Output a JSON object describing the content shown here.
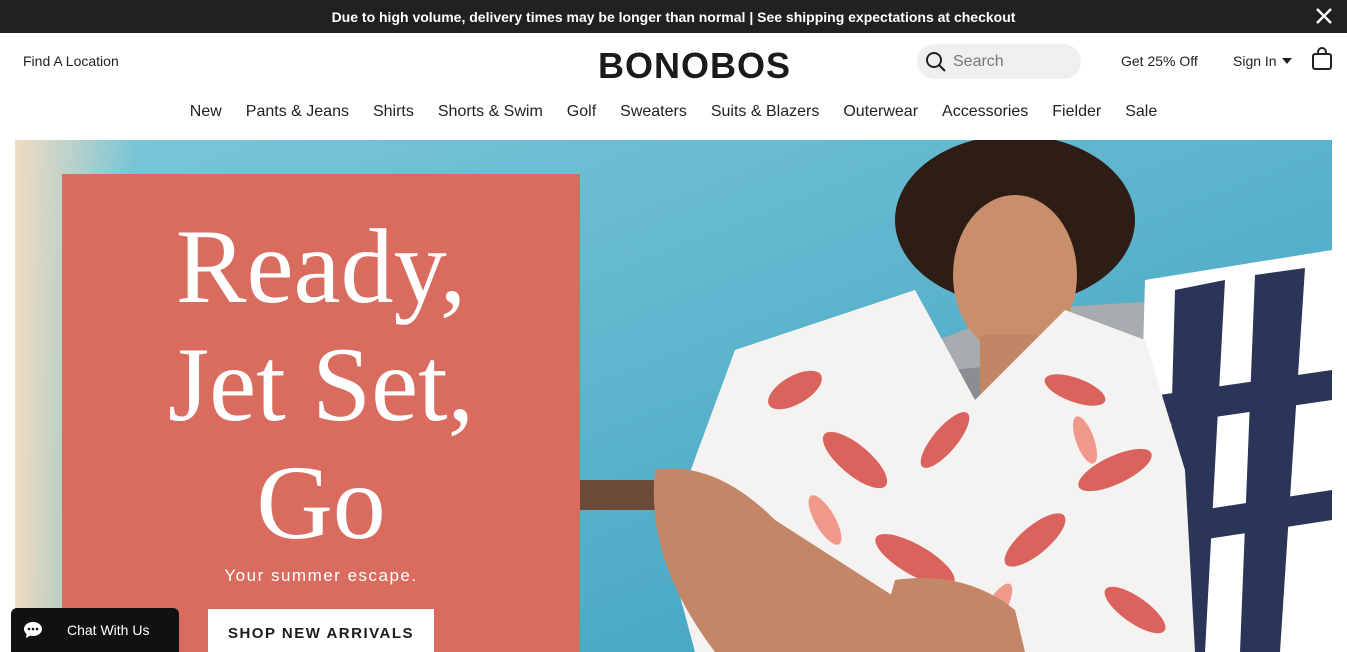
{
  "announcement": {
    "text": "Due to high volume, delivery times may be longer than normal | See shipping expectations at checkout",
    "close_icon": "close-icon"
  },
  "header": {
    "find_location": "Find A Location",
    "logo": "BONOBOS",
    "search_placeholder": "Search",
    "promo": "Get 25% Off",
    "sign_in": "Sign In",
    "bag_icon": "shopping-bag-icon"
  },
  "nav": {
    "items": [
      {
        "label": "New"
      },
      {
        "label": "Pants & Jeans"
      },
      {
        "label": "Shirts"
      },
      {
        "label": "Shorts & Swim"
      },
      {
        "label": "Golf"
      },
      {
        "label": "Sweaters"
      },
      {
        "label": "Suits & Blazers"
      },
      {
        "label": "Outerwear"
      },
      {
        "label": "Accessories"
      },
      {
        "label": "Fielder"
      },
      {
        "label": "Sale"
      }
    ]
  },
  "hero": {
    "headline_line1": "Ready,",
    "headline_line2": "Jet Set,",
    "headline_line3": "Go",
    "tagline": "Your summer escape.",
    "cta": "SHOP NEW ARRIVALS",
    "panel_color": "#d96c5f"
  },
  "chat": {
    "label": "Chat With Us",
    "icon": "chat-bubble-icon"
  }
}
